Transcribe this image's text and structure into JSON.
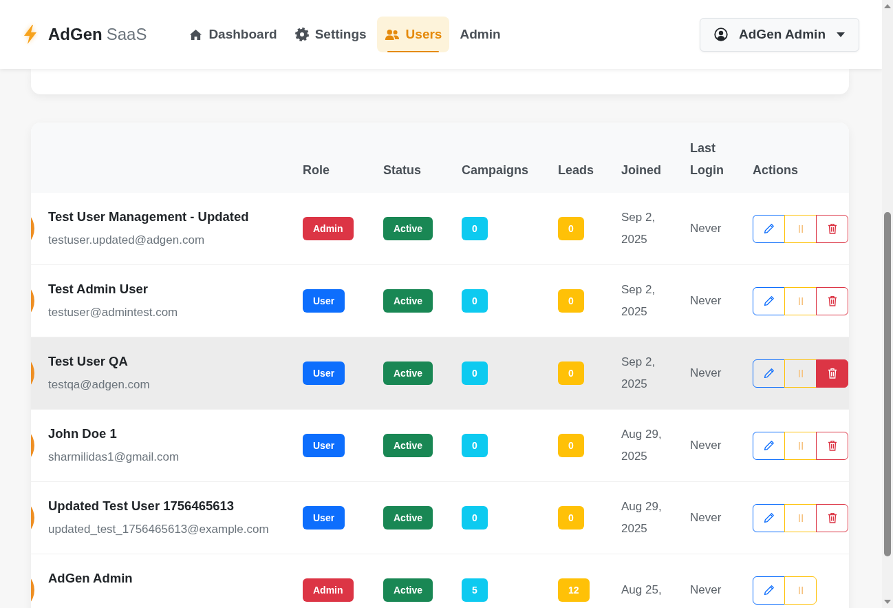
{
  "nav": {
    "brand": {
      "name": "AdGen",
      "suffix": "SaaS"
    },
    "links": [
      {
        "label": "Dashboard",
        "selected": false
      },
      {
        "label": "Settings",
        "selected": false
      },
      {
        "label": "Users",
        "selected": true
      },
      {
        "label": "Admin",
        "selected": false
      }
    ],
    "user_menu": {
      "label": "AdGen Admin"
    }
  },
  "users_table": {
    "columns": [
      "Role",
      "Status",
      "Campaigns",
      "Leads",
      "Joined",
      "Last Login",
      "Actions"
    ],
    "rows": [
      {
        "name": "Test User Management - Updated",
        "email": "testuser.updated@adgen.com",
        "role": {
          "label": "Admin",
          "color": "#dc3545"
        },
        "status": {
          "label": "Active",
          "color": "#198754"
        },
        "campaigns": "0",
        "leads": "0",
        "joined": "Sep 2, 2025",
        "last_login": "Never",
        "hovered": false,
        "actions": [
          {
            "kind": "edit"
          },
          {
            "kind": "pause"
          },
          {
            "kind": "delete"
          }
        ]
      },
      {
        "name": "Test Admin User",
        "email": "testuser@admintest.com",
        "role": {
          "label": "User",
          "color": "#0d6efd"
        },
        "status": {
          "label": "Active",
          "color": "#198754"
        },
        "campaigns": "0",
        "leads": "0",
        "joined": "Sep 2, 2025",
        "last_login": "Never",
        "hovered": false,
        "actions": [
          {
            "kind": "edit"
          },
          {
            "kind": "pause"
          },
          {
            "kind": "delete"
          }
        ]
      },
      {
        "name": "Test User QA",
        "email": "testqa@adgen.com",
        "role": {
          "label": "User",
          "color": "#0d6efd"
        },
        "status": {
          "label": "Active",
          "color": "#198754"
        },
        "campaigns": "0",
        "leads": "0",
        "joined": "Sep 2, 2025",
        "last_login": "Never",
        "hovered": true,
        "actions": [
          {
            "kind": "edit"
          },
          {
            "kind": "pause"
          },
          {
            "kind": "delete"
          }
        ]
      },
      {
        "name": "John Doe 1",
        "email": "sharmilidas1@gmail.com",
        "role": {
          "label": "User",
          "color": "#0d6efd"
        },
        "status": {
          "label": "Active",
          "color": "#198754"
        },
        "campaigns": "0",
        "leads": "0",
        "joined": "Aug 29, 2025",
        "last_login": "Never",
        "hovered": false,
        "actions": [
          {
            "kind": "edit"
          },
          {
            "kind": "pause"
          },
          {
            "kind": "delete"
          }
        ]
      },
      {
        "name": "Updated Test User 1756465613",
        "email": "updated_test_1756465613@example.com",
        "role": {
          "label": "User",
          "color": "#0d6efd"
        },
        "status": {
          "label": "Active",
          "color": "#198754"
        },
        "campaigns": "0",
        "leads": "0",
        "joined": "Aug 29, 2025",
        "last_login": "Never",
        "hovered": false,
        "actions": [
          {
            "kind": "edit"
          },
          {
            "kind": "pause"
          },
          {
            "kind": "delete"
          }
        ]
      },
      {
        "name": "AdGen Admin",
        "role": {
          "label": "Admin",
          "color": "#dc3545"
        },
        "status": {
          "label": "Active",
          "color": "#198754"
        },
        "campaigns": "5",
        "leads": "12",
        "joined": "Aug 25,",
        "last_login": "Never",
        "hovered": false,
        "actions": [
          {
            "kind": "edit"
          },
          {
            "kind": "pause"
          }
        ]
      }
    ]
  }
}
